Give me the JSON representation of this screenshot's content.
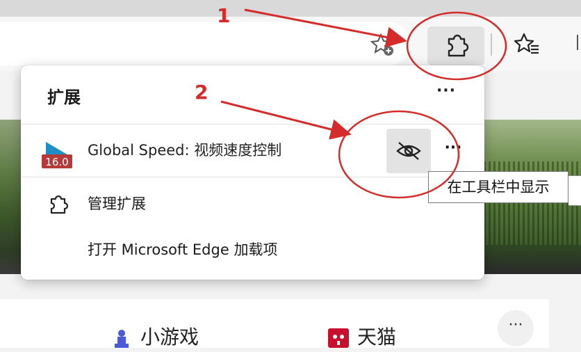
{
  "toolbar": {
    "add_favorite_icon": "star-plus-icon",
    "extensions_icon": "puzzle-icon",
    "favorites_icon": "star-list-icon"
  },
  "extensions_popup": {
    "title": "扩展",
    "more_label": "···",
    "extension": {
      "name": "Global Speed: 视频速度控制",
      "badge": "16.0",
      "row_more_label": "···",
      "visibility_icon": "eye-slash-icon"
    },
    "manage_label": "管理扩展",
    "open_addons_label": "打开 Microsoft Edge 加载项"
  },
  "tooltip": {
    "text": "在工具栏中显示"
  },
  "quick_links": [
    {
      "label": "小游戏"
    },
    {
      "label": "天猫"
    }
  ],
  "card_more_label": "···",
  "annotations": {
    "step1": "1",
    "step2": "2",
    "color": "#d42b2b"
  }
}
